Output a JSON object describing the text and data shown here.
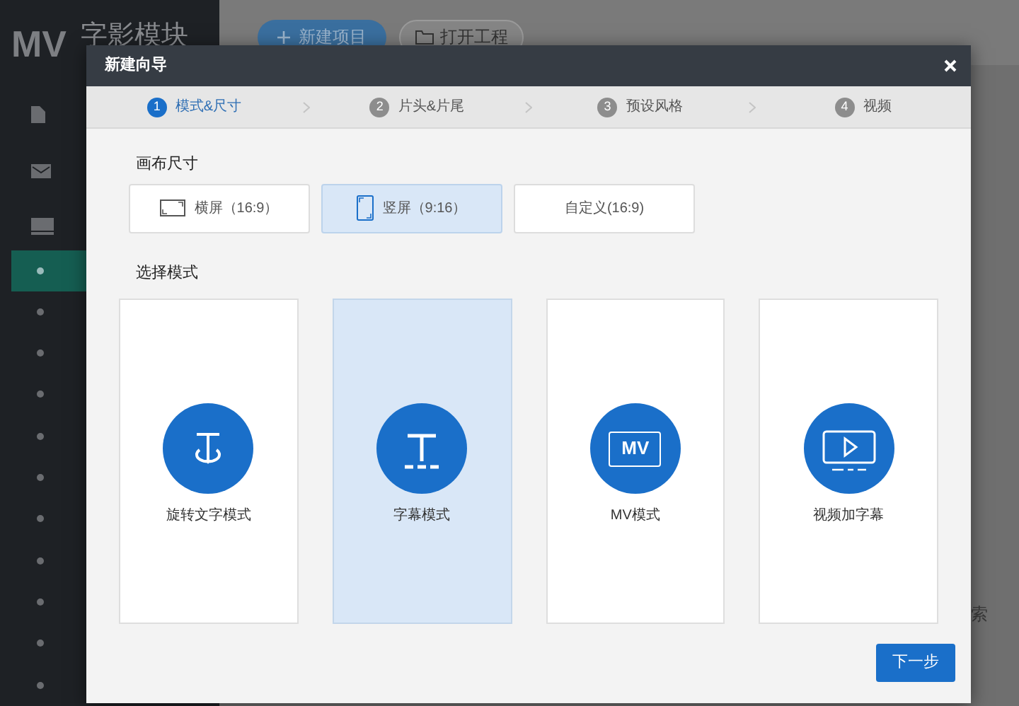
{
  "background": {
    "logo": "MV",
    "app_name": "字影模块",
    "toolbar_buttons": [
      {
        "label": "新建项目",
        "kind": "primary"
      },
      {
        "label": "打开工程",
        "kind": "folder"
      }
    ],
    "side_text": "索"
  },
  "dialog": {
    "title": "新建向导",
    "steps": [
      {
        "number": "1",
        "label": "模式&尺寸",
        "selected": true
      },
      {
        "number": "2",
        "label": "片头&片尾",
        "selected": false
      },
      {
        "number": "3",
        "label": "预设风格",
        "selected": false
      },
      {
        "number": "4",
        "label": "视频",
        "selected": false
      }
    ],
    "canvas_label": "画布尺寸",
    "canvas_sizes": [
      {
        "label": "横屏（16:9）",
        "kind": "landscape",
        "selected": false
      },
      {
        "label": "竖屏（9:16）",
        "kind": "portrait",
        "selected": true
      },
      {
        "label": "自定义(16:9)",
        "kind": "custom",
        "selected": false
      }
    ],
    "mode_label": "选择模式",
    "modes": [
      {
        "label": "旋转文字模式",
        "kind": "rotate",
        "selected": false
      },
      {
        "label": "字幕模式",
        "kind": "subtitle",
        "selected": true
      },
      {
        "label": "MV模式",
        "kind": "mv",
        "badge": "MV",
        "selected": false
      },
      {
        "label": "视频加字幕",
        "kind": "video",
        "selected": false
      }
    ],
    "next_button": "下一步"
  }
}
